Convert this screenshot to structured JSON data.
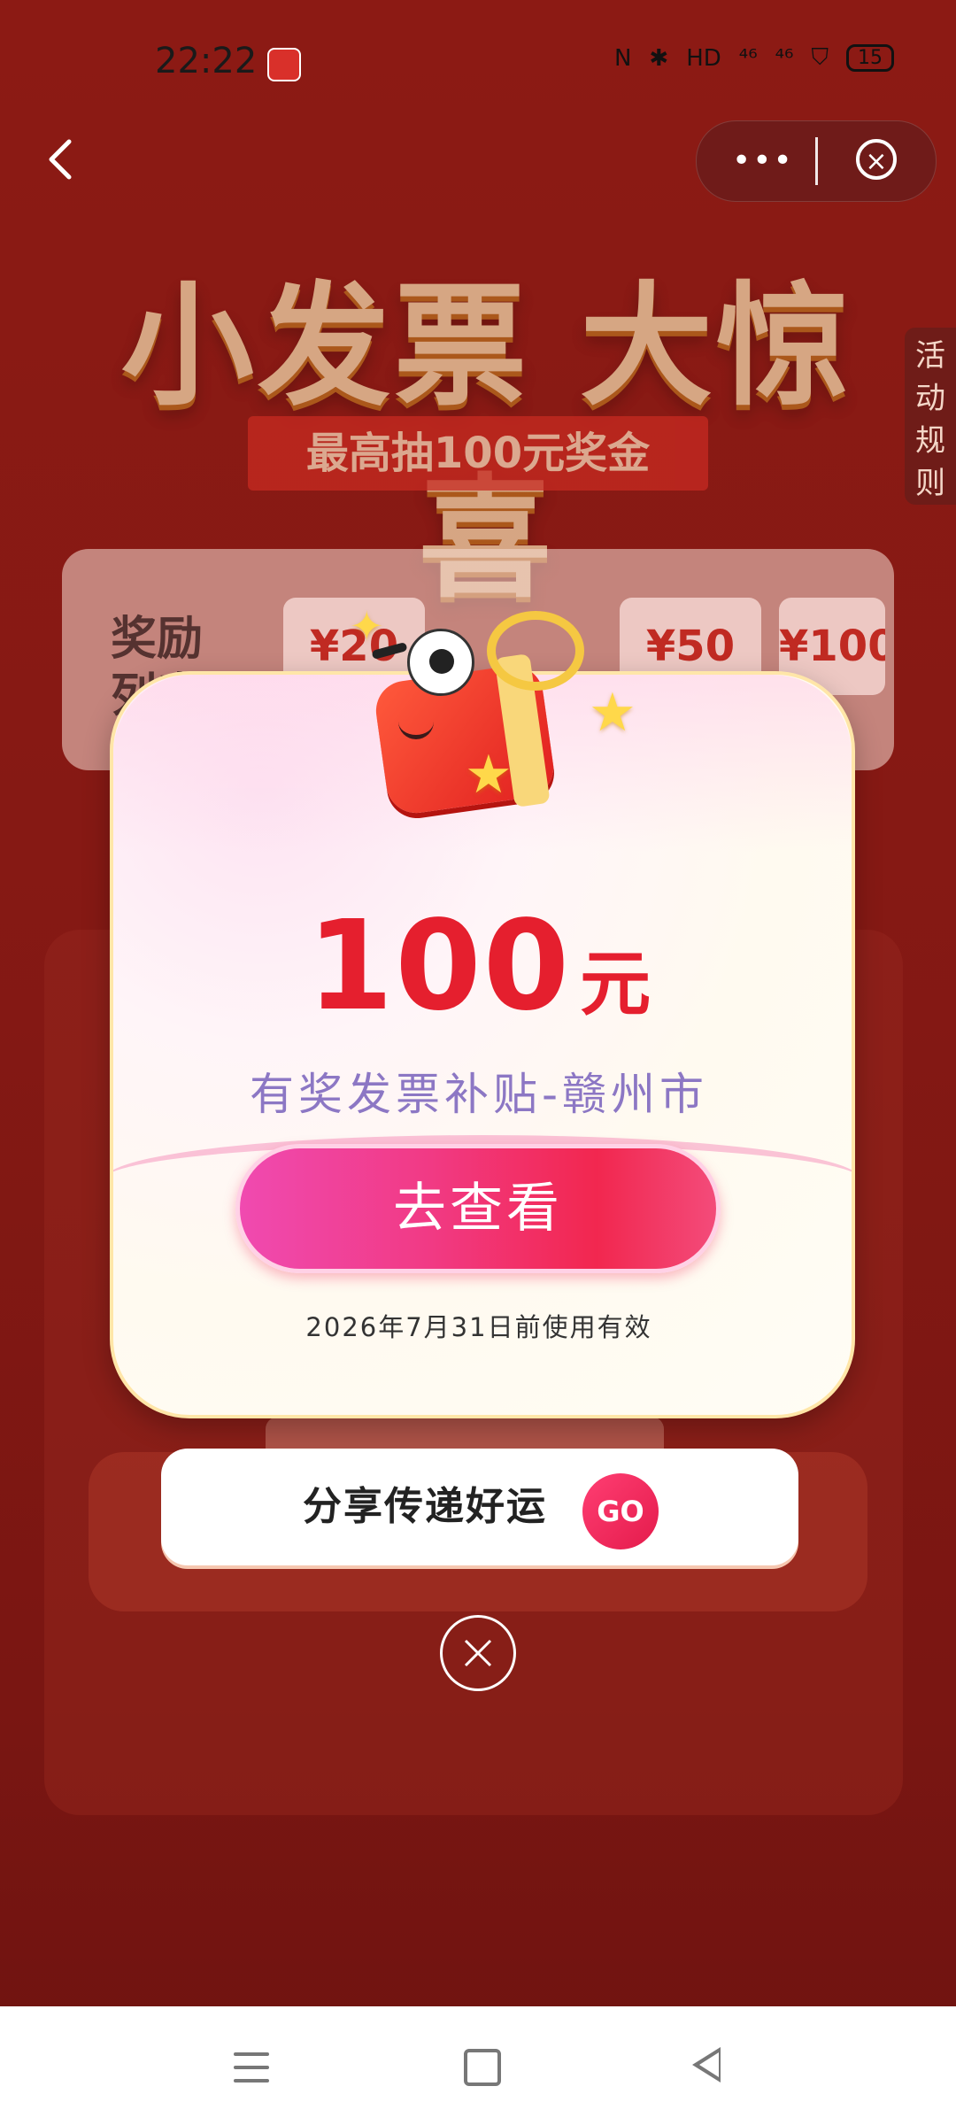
{
  "status_bar": {
    "time": "22:22",
    "right_icons": [
      "N",
      "✱",
      "HD",
      "⁴⁶",
      "⁴⁶",
      "⛉"
    ],
    "battery": "15"
  },
  "nav": {
    "back_icon": "chevron-left-icon",
    "more_label": "•••",
    "close_label": "×"
  },
  "banner": {
    "title": "小发票 大惊喜",
    "subtitle": "最高抽100元奖金"
  },
  "rules_tab": "活动规则",
  "reward_list": {
    "title": "奖励列表",
    "chips": [
      "¥20",
      "¥50",
      "¥100"
    ]
  },
  "modal": {
    "amount": "100",
    "unit": "元",
    "description": "有奖发票补贴-赣州市",
    "cta_label": "去查看",
    "expiry": "2026年7月31日前使用有效"
  },
  "share": {
    "label": "分享传递好运",
    "go_label": "GO"
  },
  "modal_close_label": "×",
  "colors": {
    "amount": "#e51f2e",
    "description": "#8c77c4",
    "cta_start": "#f04ab0",
    "cta_end": "#f2274f",
    "background": "#861914"
  }
}
